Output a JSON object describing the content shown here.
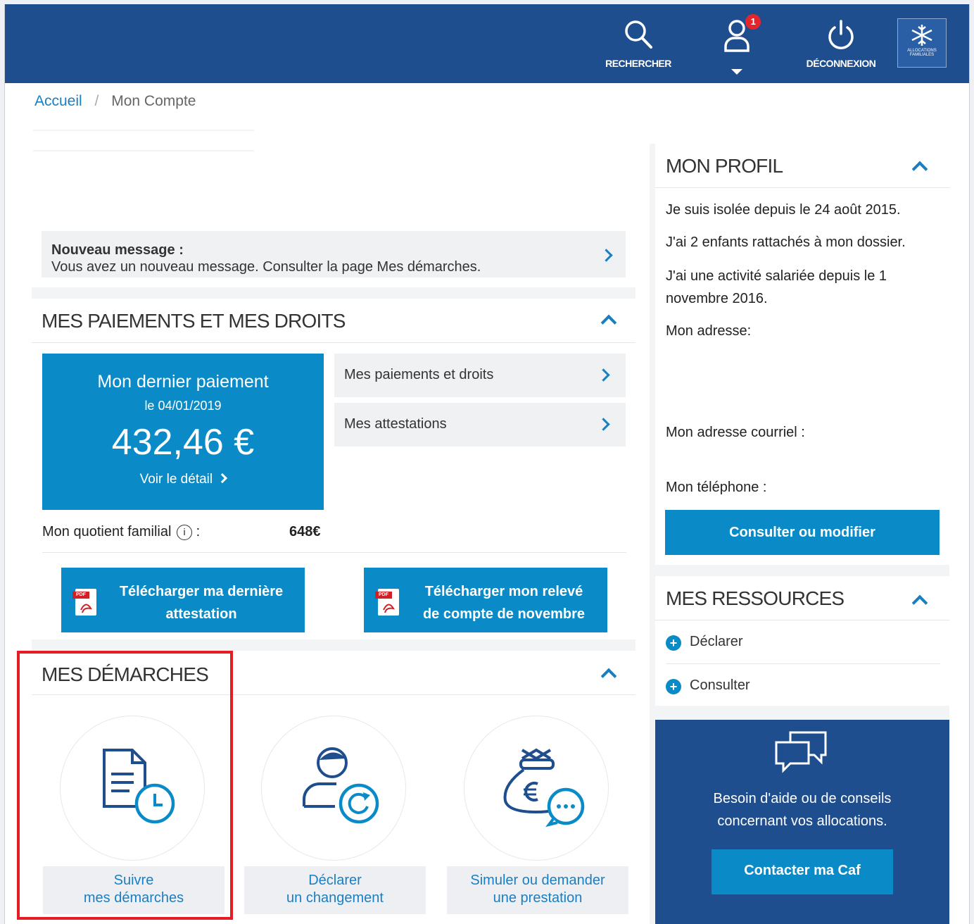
{
  "header": {
    "search_label": "RECHERCHER",
    "notifications_count": "1",
    "logout_label": "DÉCONNEXION",
    "logo_text": "ALLOCATIONS FAMILIALES"
  },
  "breadcrumb": {
    "home": "Accueil",
    "separator": "/",
    "current": "Mon Compte"
  },
  "message": {
    "title": "Nouveau message :",
    "body": "Vous avez un nouveau message. Consulter la page Mes démarches."
  },
  "payments": {
    "title": "MES PAIEMENTS ET MES DROITS",
    "last_payment_label": "Mon dernier paiement",
    "last_payment_date": "le 04/01/2019",
    "last_payment_amount": "432,46 €",
    "detail_link": "Voir le détail",
    "links": [
      "Mes paiements et droits",
      "Mes attestations"
    ],
    "quotient_label": "Mon quotient familial",
    "quotient_colon": ":",
    "quotient_value": "648€",
    "btn_attestation_line1": "Télécharger ma dernière",
    "btn_attestation_line2": "attestation",
    "btn_releve_line1": "Télécharger mon relevé",
    "btn_releve_line2": "de compte de novembre",
    "pdf_tag": "PDF"
  },
  "demarches": {
    "title": "MES DÉMARCHES",
    "items": [
      {
        "line1": "Suivre",
        "line2": "mes démarches"
      },
      {
        "line1": "Déclarer",
        "line2": "un changement"
      },
      {
        "line1": "Simuler ou demander",
        "line2": "une prestation"
      }
    ]
  },
  "profile": {
    "title": "MON PROFIL",
    "line1": "Je suis isolée depuis le 24 août 2015.",
    "line2": "J'ai 2 enfants rattachés à mon dossier.",
    "line3a": "J'ai une activité salariée depuis le 1",
    "line3b": "novembre 2016.",
    "address_label": "Mon adresse:",
    "email_label": "Mon adresse courriel :",
    "phone_label": "Mon téléphone :",
    "button": "Consulter ou modifier"
  },
  "resources": {
    "title": "MES RESSOURCES",
    "items": [
      "Déclarer",
      "Consulter"
    ]
  },
  "help": {
    "line1": "Besoin d'aide ou de conseils",
    "line2": "concernant vos allocations.",
    "button": "Contacter ma Caf"
  },
  "colors": {
    "header": "#1f4e8f",
    "accent": "#0a8bc8",
    "link": "#1a7fc1",
    "highlight": "#e51c23"
  }
}
